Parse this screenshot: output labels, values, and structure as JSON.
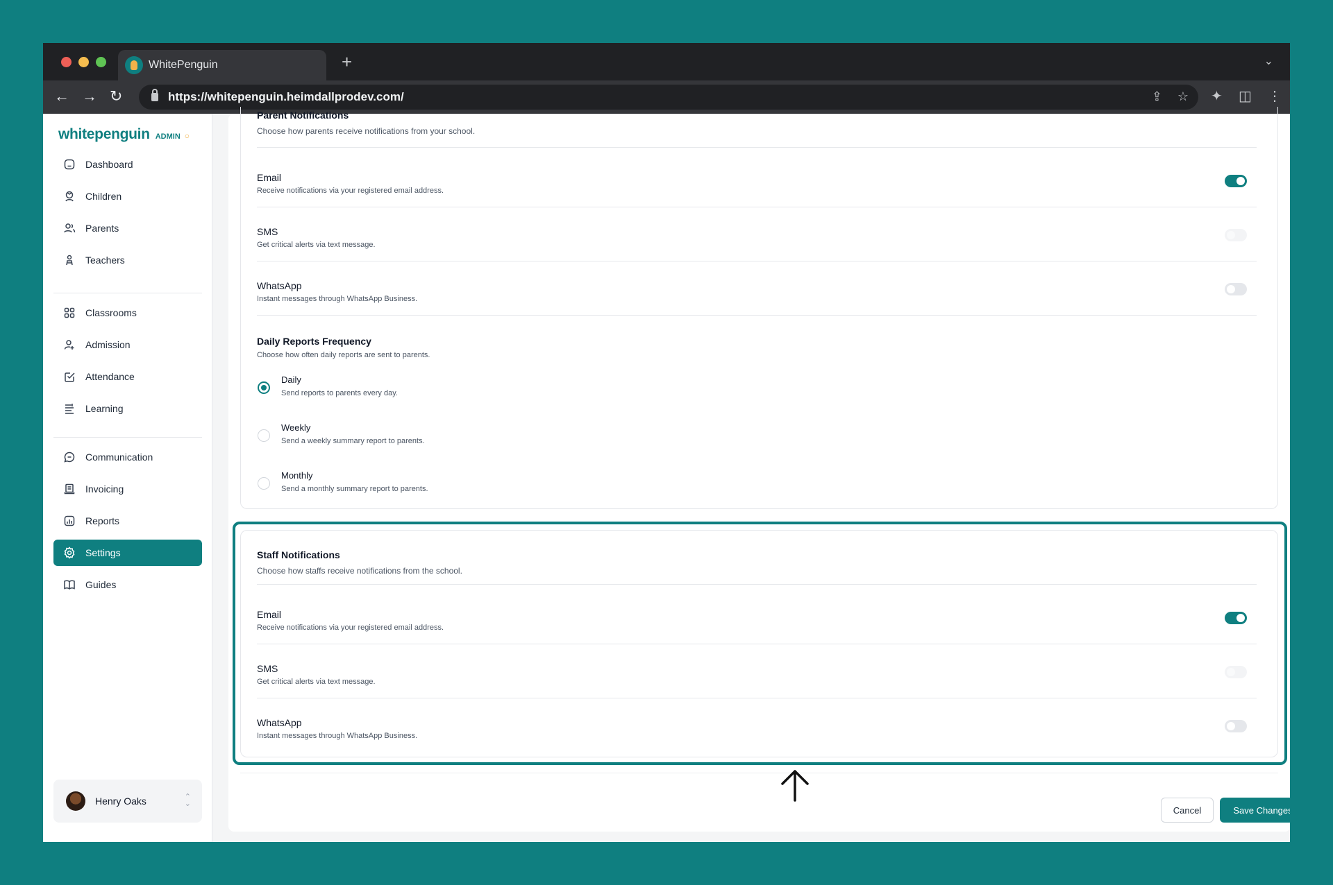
{
  "browser": {
    "tab_title": "WhitePenguin",
    "url": "https://whitepenguin.heimdallprodev.com/"
  },
  "sidebar": {
    "logo": "whitepenguin",
    "admin_label": "ADMIN",
    "items": [
      {
        "label": "Dashboard",
        "icon": "home-icon"
      },
      {
        "label": "Children",
        "icon": "child-icon"
      },
      {
        "label": "Parents",
        "icon": "parents-icon"
      },
      {
        "label": "Teachers",
        "icon": "teacher-icon"
      },
      {
        "label": "Classrooms",
        "icon": "grid-icon"
      },
      {
        "label": "Admission",
        "icon": "user-plus-icon"
      },
      {
        "label": "Attendance",
        "icon": "check-square-icon"
      },
      {
        "label": "Learning",
        "icon": "learning-icon"
      },
      {
        "label": "Communication",
        "icon": "chat-icon"
      },
      {
        "label": "Invoicing",
        "icon": "invoice-icon"
      },
      {
        "label": "Reports",
        "icon": "chart-icon"
      },
      {
        "label": "Settings",
        "icon": "gear-icon",
        "active": true
      },
      {
        "label": "Guides",
        "icon": "book-icon"
      }
    ],
    "user": {
      "name": "Henry Oaks"
    }
  },
  "parent_notifications": {
    "title": "Parent Notifications",
    "description": "Choose how parents receive notifications from your school.",
    "channels": [
      {
        "label": "Email",
        "description": "Receive notifications via your registered email address.",
        "enabled": true
      },
      {
        "label": "SMS",
        "description": "Get critical alerts via text message.",
        "enabled": false
      },
      {
        "label": "WhatsApp",
        "description": "Instant messages through WhatsApp Business.",
        "enabled": false
      }
    ],
    "frequency": {
      "title": "Daily Reports Frequency",
      "description": "Choose how often daily reports are sent to parents.",
      "selected": "Daily",
      "options": [
        {
          "label": "Daily",
          "description": "Send reports to parents every day."
        },
        {
          "label": "Weekly",
          "description": "Send a weekly summary report to parents."
        },
        {
          "label": "Monthly",
          "description": "Send a monthly summary report to parents."
        }
      ]
    }
  },
  "staff_notifications": {
    "title": "Staff Notifications",
    "description": "Choose how staffs receive notifications from the school.",
    "channels": [
      {
        "label": "Email",
        "description": "Receive notifications via your registered email address.",
        "enabled": true
      },
      {
        "label": "SMS",
        "description": "Get critical alerts via text message.",
        "enabled": false
      },
      {
        "label": "WhatsApp",
        "description": "Instant messages through WhatsApp Business.",
        "enabled": false
      }
    ]
  },
  "actions": {
    "cancel": "Cancel",
    "save": "Save Changes"
  },
  "colors": {
    "accent": "#0f7f80",
    "brand_badge": "#f1b24a"
  }
}
